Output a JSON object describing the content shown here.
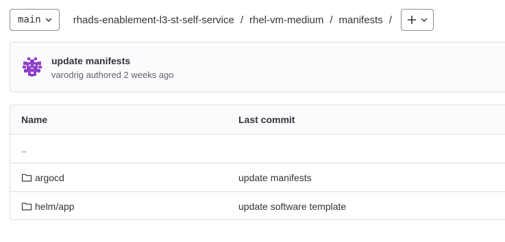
{
  "branch": {
    "name": "main",
    "icon": "chevron-down-icon"
  },
  "breadcrumb": {
    "items": [
      {
        "label": "rhads-enablement-l3-st-self-service"
      },
      {
        "label": "rhel-vm-medium"
      },
      {
        "label": "manifests"
      }
    ],
    "separator": "/"
  },
  "add_menu": {
    "icon": "plus-icon"
  },
  "last_commit": {
    "title": "update manifests",
    "author": "varodrig",
    "authored_text": "authored",
    "time": "2 weeks ago",
    "avatar_color": "#8f3fc7"
  },
  "table": {
    "headers": {
      "name": "Name",
      "last_commit": "Last commit"
    },
    "parent_dir": "..",
    "rows": [
      {
        "name": "argocd",
        "icon": "folder-icon",
        "last_commit": "update manifests"
      },
      {
        "name": "helm/app",
        "icon": "folder-icon",
        "last_commit": "update software template"
      }
    ]
  },
  "colors": {
    "text": "#333238",
    "muted": "#626168",
    "border": "#dcdcde",
    "panel_bg": "#fbfafd"
  }
}
